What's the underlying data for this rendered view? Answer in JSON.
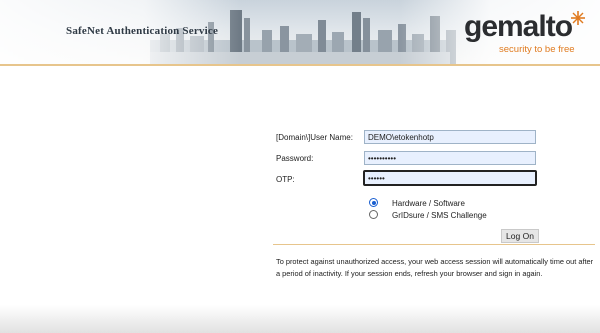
{
  "header": {
    "app_title": "SafeNet Authentication Service",
    "logo_text": "gemalto",
    "logo_tagline": "security to be free"
  },
  "form": {
    "username_label": "[Domain\\]User Name:",
    "username_value": "DEMO\\etokenhotp",
    "password_label": "Password:",
    "password_value": "••••••••••",
    "otp_label": "OTP:",
    "otp_value": "••••••",
    "options": [
      {
        "label": "Hardware / Software",
        "selected": true
      },
      {
        "label": "GrIDsure / SMS Challenge",
        "selected": false
      }
    ],
    "logon_label": "Log On"
  },
  "notice": "To protect against unauthorized access, your web access session will automatically time out after a period of inactivity. If your session ends, refresh your browser and sign in again.",
  "colors": {
    "accent_orange": "#e07b20",
    "divider": "#e7c58c",
    "field_bg": "#e8f0fe"
  }
}
